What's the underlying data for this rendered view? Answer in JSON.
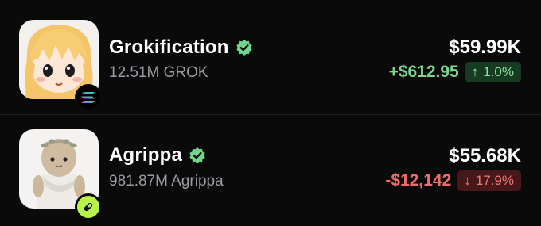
{
  "tokens": [
    {
      "name": "Grokification",
      "holdings": "12.51M GROK",
      "value": "$59.99K",
      "change_amount": "+$612.95",
      "change_direction": "up",
      "arrow": "↑",
      "change_percent": "1.0%",
      "avatar_icon": "anime-girl-avatar-icon",
      "chain_icon": "solana-icon",
      "verified_icon": "verified-check-icon"
    },
    {
      "name": "Agrippa",
      "holdings": "981.87M Agrippa",
      "value": "$55.68K",
      "change_amount": "-$12,142",
      "change_direction": "down",
      "arrow": "↓",
      "change_percent": "17.9%",
      "avatar_icon": "laurel-figure-avatar-icon",
      "chain_icon": "pump-pill-icon",
      "verified_icon": "verified-check-icon"
    }
  ],
  "colors": {
    "background": "#0a0a0b",
    "positive": "#7bd88f",
    "negative": "#f26b6b",
    "verified": "#6fd68b",
    "muted_text": "#9a9ca3"
  }
}
